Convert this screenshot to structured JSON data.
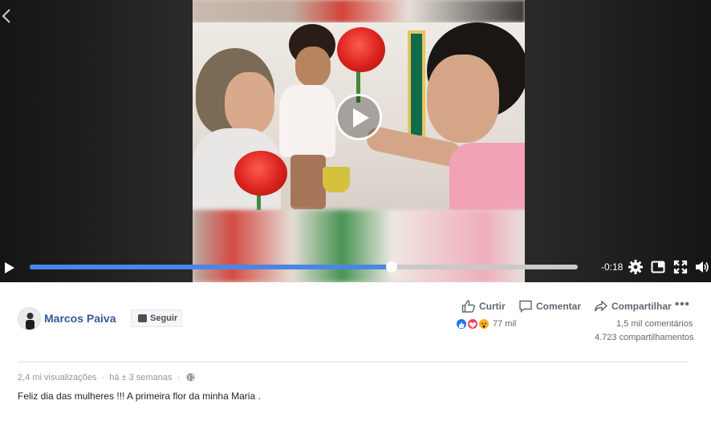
{
  "player": {
    "time_remaining": "-0:18",
    "progress_fraction": 0.66,
    "icons": {
      "back": "chevron-left-icon",
      "center": "play-circle-icon",
      "play": "play-icon",
      "settings": "gear-icon",
      "miniplayer": "miniplayer-icon",
      "fullscreen": "fullscreen-icon",
      "volume": "volume-icon"
    },
    "colors": {
      "progress": "#4a86e8",
      "track": "#c9c9c9"
    }
  },
  "post": {
    "author": "Marcos Paiva",
    "follow_label": "Seguir",
    "actions": {
      "like": "Curtir",
      "comment": "Comentar",
      "share": "Compartilhar",
      "more": "•••"
    },
    "reactions": {
      "types": [
        "like",
        "love",
        "wow"
      ],
      "count": "77 mil"
    },
    "comments_count": "1,5 mil comentários",
    "shares_count": "4.723 compartilhamentos",
    "views": "2,4 mi visualizações",
    "separator": "·",
    "time_ago": "há ± 3 semanas",
    "caption": "Feliz dia das mulheres !!! A primeira flor da minha Maria .",
    "colors": {
      "author": "#365899",
      "meta": "#90949c",
      "action": "#606770"
    }
  }
}
